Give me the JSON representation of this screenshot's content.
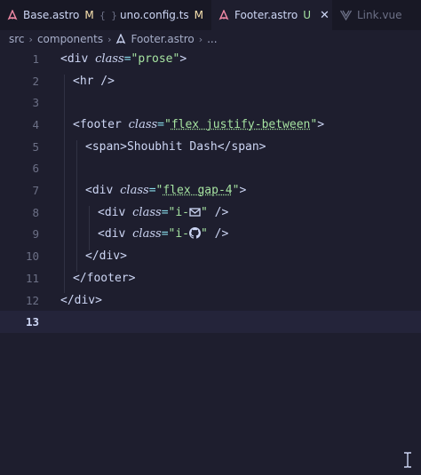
{
  "tabs": [
    {
      "label": "Base.astro",
      "badge": "M",
      "icon": "astro-icon"
    },
    {
      "label": "uno.config.ts",
      "badge": "M",
      "icon": "braces-icon"
    },
    {
      "label": "Footer.astro",
      "badge": "U",
      "icon": "astro-icon",
      "active": true,
      "close": "✕"
    },
    {
      "label": "Link.vue",
      "icon": "vue-icon"
    }
  ],
  "breadcrumb": {
    "items": [
      "src",
      "components",
      "Footer.astro",
      "..."
    ],
    "sep": "›"
  },
  "editor": {
    "line_numbers": [
      "1",
      "2",
      "3",
      "4",
      "5",
      "6",
      "7",
      "8",
      "9",
      "10",
      "11",
      "12",
      "13"
    ],
    "current_line": "13",
    "lines": {
      "l1": {
        "open": "<div ",
        "attr": "class",
        "eq": "=",
        "val": "\"prose\"",
        "close": ">"
      },
      "l2": {
        "text": "<hr />"
      },
      "l4": {
        "open": "<footer ",
        "attr": "class",
        "eq": "=",
        "val_q1": "\"",
        "val": "flex justify-between",
        "val_q2": "\"",
        "close": ">"
      },
      "l5": {
        "open": "<span>",
        "text": "Shoubhit Dash",
        "close": "</span>"
      },
      "l7": {
        "open": "<div ",
        "attr": "class",
        "eq": "=",
        "val_q1": "\"",
        "val": "flex gap-4",
        "val_q2": "\"",
        "close": ">"
      },
      "l8": {
        "open": "<div ",
        "attr": "class",
        "eq": "=",
        "val_a": "\"i-",
        "val_b": "\"",
        "close": " />",
        "icon": "mail-icon"
      },
      "l9": {
        "open": "<div ",
        "attr": "class",
        "eq": "=",
        "val_a": "\"i-",
        "val_b": "\"",
        "close": " />",
        "icon": "github-icon"
      },
      "l10": {
        "text": "</div>"
      },
      "l11": {
        "text": "</footer>"
      },
      "l12": {
        "text": "</div>"
      }
    }
  },
  "colors": {
    "background": "#1e1e2e",
    "tabbar": "#181825",
    "string": "#a6e3a1",
    "modified_badge": "#f9e2af",
    "untracked_badge": "#a6e3a1"
  }
}
